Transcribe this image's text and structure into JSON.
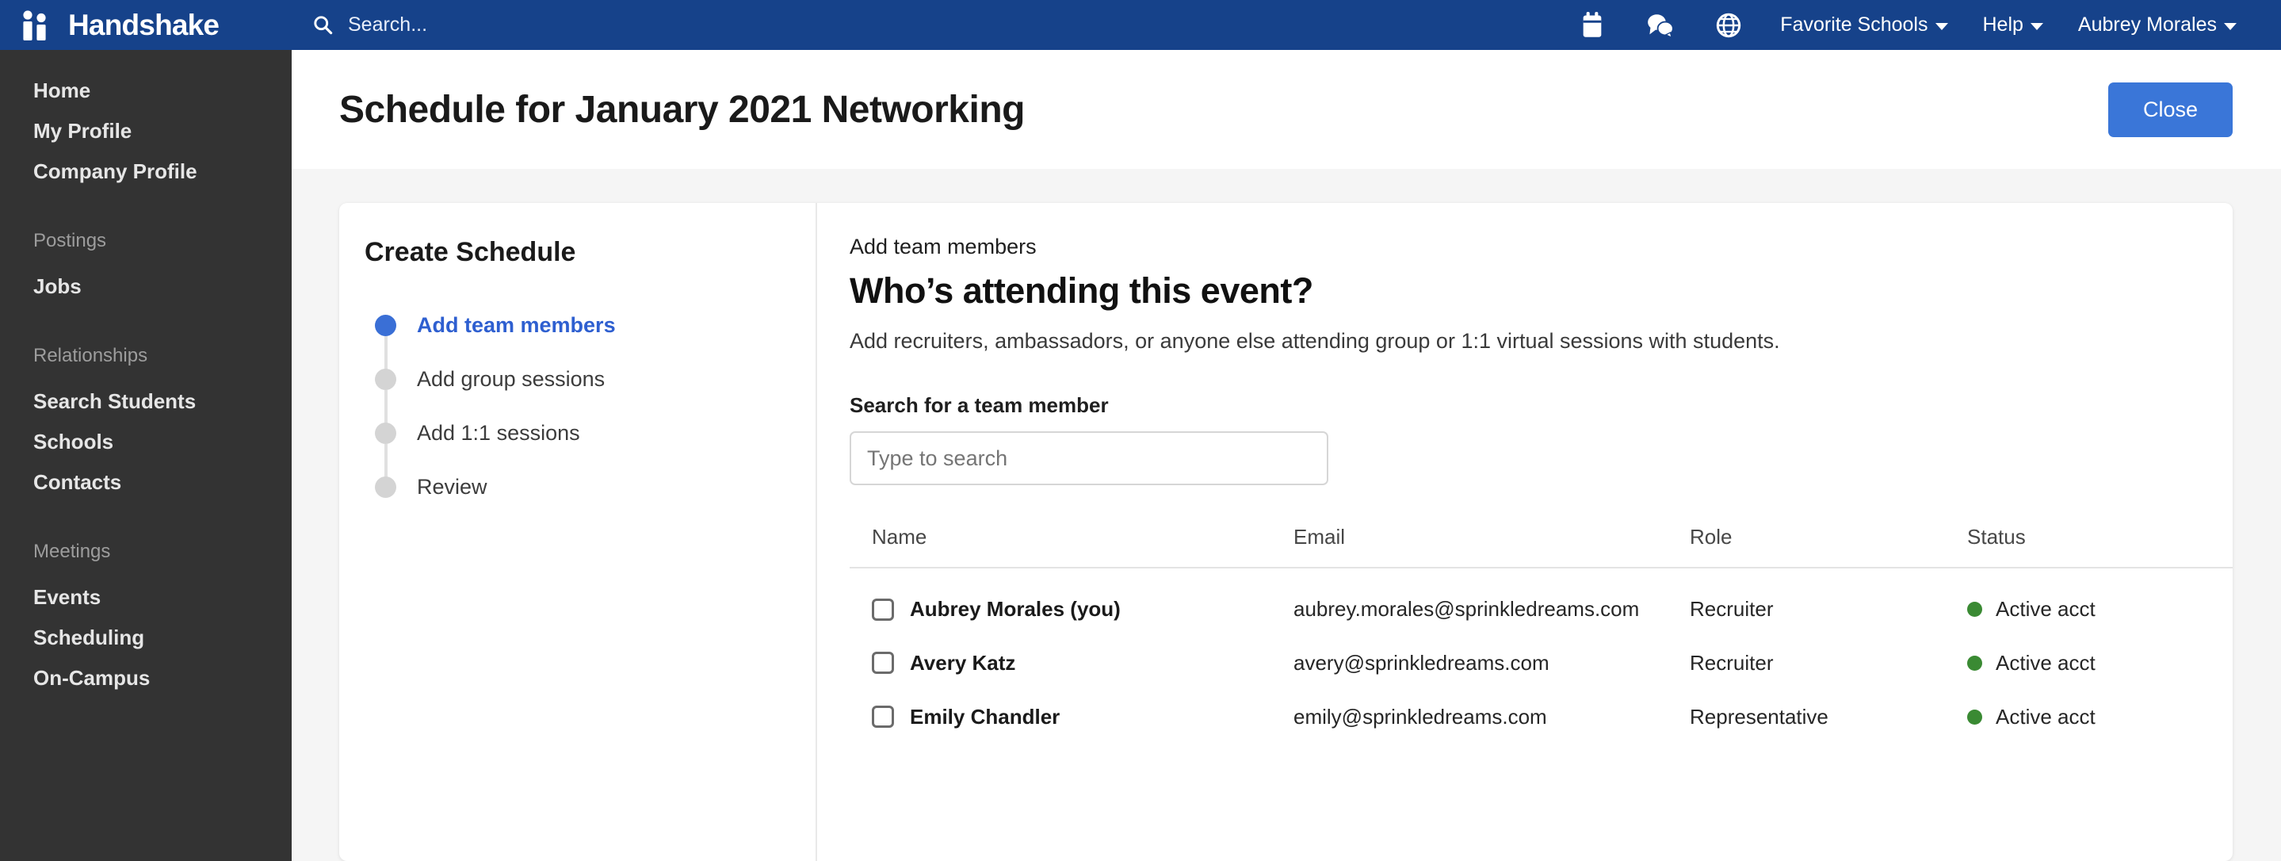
{
  "nav": {
    "brand": "Handshake",
    "search_placeholder": "Search...",
    "icons": [
      "calendar-icon",
      "messages-icon",
      "globe-icon"
    ],
    "links": [
      {
        "label": "Favorite Schools",
        "caret": true
      },
      {
        "label": "Help",
        "caret": true
      },
      {
        "label": "Aubrey Morales",
        "caret": true
      }
    ]
  },
  "sidebar": {
    "items": [
      {
        "label": "Home",
        "type": "item"
      },
      {
        "label": "My Profile",
        "type": "item"
      },
      {
        "label": "Company Profile",
        "type": "item"
      },
      {
        "label": "Postings",
        "type": "section"
      },
      {
        "label": "Jobs",
        "type": "item"
      },
      {
        "label": "Relationships",
        "type": "section"
      },
      {
        "label": "Search Students",
        "type": "item"
      },
      {
        "label": "Schools",
        "type": "item"
      },
      {
        "label": "Contacts",
        "type": "item"
      },
      {
        "label": "Meetings",
        "type": "section"
      },
      {
        "label": "Events",
        "type": "item"
      },
      {
        "label": "Scheduling",
        "type": "item"
      },
      {
        "label": "On-Campus",
        "type": "item"
      }
    ]
  },
  "header": {
    "title": "Schedule for January 2021 Networking",
    "close_label": "Close"
  },
  "wizard": {
    "title": "Create Schedule",
    "steps": [
      {
        "label": "Add team members",
        "active": true
      },
      {
        "label": "Add group sessions",
        "active": false
      },
      {
        "label": "Add 1:1 sessions",
        "active": false
      },
      {
        "label": "Review",
        "active": false
      }
    ]
  },
  "panel": {
    "eyebrow": "Add team members",
    "heading": "Who’s attending this event?",
    "subtitle": "Add recruiters, ambassadors, or anyone else attending group or 1:1 virtual sessions with students.",
    "search_label": "Search for a team member",
    "search_placeholder": "Type to search",
    "search_value": ""
  },
  "table": {
    "columns": [
      "Name",
      "Email",
      "Role",
      "Status"
    ],
    "rows": [
      {
        "checked": false,
        "name": "Aubrey Morales (you)",
        "email": "aubrey.morales@sprinkledreams.com",
        "role": "Recruiter",
        "status": "Active acct"
      },
      {
        "checked": false,
        "name": "Avery Katz",
        "email": "avery@sprinkledreams.com",
        "role": "Recruiter",
        "status": "Active acct"
      },
      {
        "checked": false,
        "name": "Emily Chandler",
        "email": "emily@sprinkledreams.com",
        "role": "Representative",
        "status": "Active acct"
      }
    ]
  },
  "colors": {
    "nav_blue": "#16428a",
    "sidebar_dark": "#333333",
    "accent_blue": "#3a76d8",
    "step_active_blue": "#2e5fd0",
    "status_green": "#3a8a33",
    "page_bg": "#f5f5f5"
  }
}
